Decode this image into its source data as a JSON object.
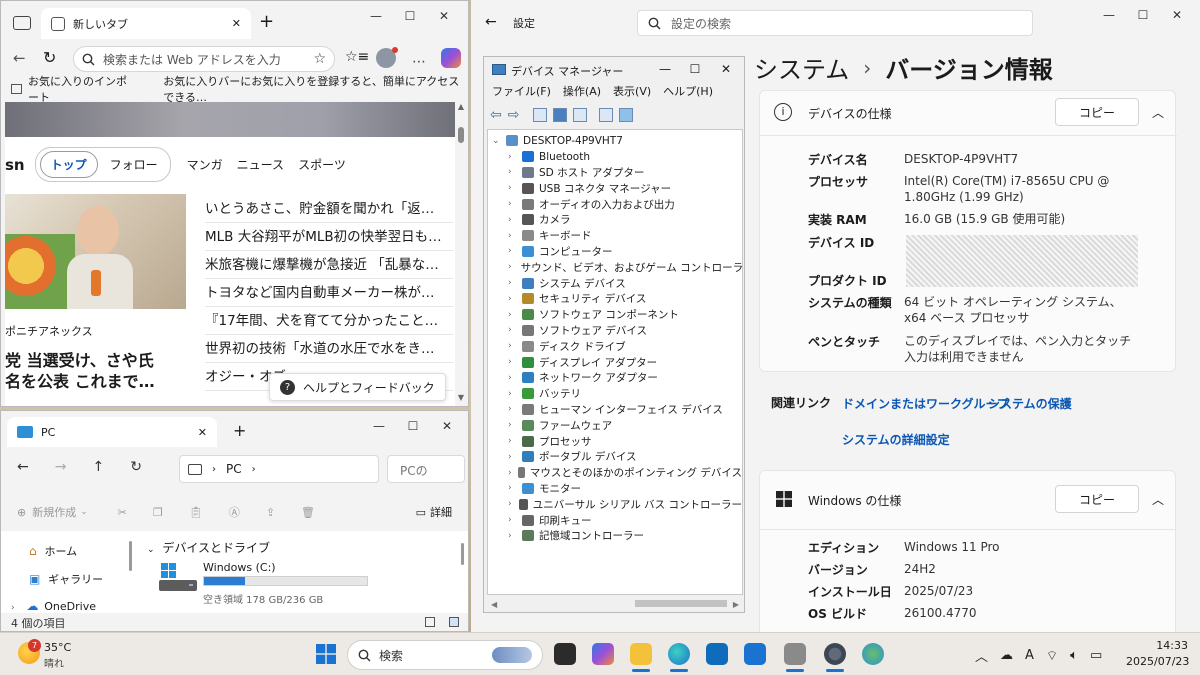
{
  "browser": {
    "tab_title": "新しいタブ",
    "address_placeholder": "検索または Web アドレスを入力",
    "favorites_import": "お気に入りのインポート",
    "favorites_hint": "お気に入りバーにお気に入りを登録すると、簡単にアクセスできる…",
    "logo_fragment": "sn",
    "tabs": [
      "トップ",
      "フォロー",
      "マンガ",
      "ニュース",
      "スポーツ"
    ],
    "news": [
      "いとうあさこ、貯金額を聞かれ「返…",
      "MLB 大谷翔平がMLB初の快挙翌日も…",
      "米旅客機に爆撃機が急接近 「乱暴な…",
      "トヨタなど国内自動車メーカー株が…",
      "『17年間、犬を育てて分かったこと…",
      "世界初の技術「水道の水圧で水をき…",
      "オジー・オズ…"
    ],
    "source": "ポニチアネックス",
    "headline_line1": "党 当選受け、さや氏",
    "headline_line2": "名を公表 これまで…",
    "help_button": "ヘルプとフィードバック"
  },
  "explorer": {
    "tab_title": "PC",
    "address_pc": "PC",
    "search_placeholder": "PCの",
    "new_label": "新規作成",
    "details_label": "詳細",
    "nav": [
      "ホーム",
      "ギャラリー",
      "OneDrive"
    ],
    "section": "デバイスとドライブ",
    "drive_name": "Windows (C:)",
    "drive_free": "空き領域 178 GB/236 GB",
    "drive_used_fraction": 0.25,
    "status": "4 個の項目"
  },
  "devmgr": {
    "title": "デバイス マネージャー",
    "menu": [
      "ファイル(F)",
      "操作(A)",
      "表示(V)",
      "ヘルプ(H)"
    ],
    "root": "DESKTOP-4P9VHT7",
    "items": [
      {
        "label": "Bluetooth",
        "color": "#1a6fd6"
      },
      {
        "label": "SD ホスト アダプター",
        "color": "#6b7b8c"
      },
      {
        "label": "USB コネクタ マネージャー",
        "color": "#555555"
      },
      {
        "label": "オーディオの入力および出力",
        "color": "#7a7a7a"
      },
      {
        "label": "カメラ",
        "color": "#555555"
      },
      {
        "label": "キーボード",
        "color": "#8a8a8a"
      },
      {
        "label": "コンピューター",
        "color": "#3b8fd4"
      },
      {
        "label": "サウンド、ビデオ、およびゲーム コントローラー",
        "color": "#6a6a6a"
      },
      {
        "label": "システム デバイス",
        "color": "#3f7fbf"
      },
      {
        "label": "セキュリティ デバイス",
        "color": "#b58b2a"
      },
      {
        "label": "ソフトウェア コンポーネント",
        "color": "#4a8a4a"
      },
      {
        "label": "ソフトウェア デバイス",
        "color": "#777777"
      },
      {
        "label": "ディスク ドライブ",
        "color": "#8a8a8a"
      },
      {
        "label": "ディスプレイ アダプター",
        "color": "#2f8f3f"
      },
      {
        "label": "ネットワーク アダプター",
        "color": "#2f7fbf"
      },
      {
        "label": "バッテリ",
        "color": "#3a9a3a"
      },
      {
        "label": "ヒューマン インターフェイス デバイス",
        "color": "#7a7a7a"
      },
      {
        "label": "ファームウェア",
        "color": "#5a8a5a"
      },
      {
        "label": "プロセッサ",
        "color": "#4a6a4a"
      },
      {
        "label": "ポータブル デバイス",
        "color": "#2f7fbf"
      },
      {
        "label": "マウスとそのほかのポインティング デバイス",
        "color": "#777777"
      },
      {
        "label": "モニター",
        "color": "#3b8fd4"
      },
      {
        "label": "ユニバーサル シリアル バス コントローラー",
        "color": "#555555"
      },
      {
        "label": "印刷キュー",
        "color": "#666666"
      },
      {
        "label": "記憶域コントローラー",
        "color": "#5a7a5a"
      }
    ]
  },
  "settings": {
    "app_title": "設定",
    "search_placeholder": "設定の検索",
    "breadcrumb_parent": "システム",
    "breadcrumb_sep": "›",
    "breadcrumb_current": "バージョン情報",
    "device_card_title": "デバイスの仕様",
    "copy_label": "コピー",
    "device_specs": [
      {
        "key": "デバイス名",
        "value": "DESKTOP-4P9VHT7"
      },
      {
        "key": "プロセッサ",
        "value": "Intel(R) Core(TM) i7-8565U CPU @ 1.80GHz (1.99 GHz)"
      },
      {
        "key": "実装 RAM",
        "value": "16.0 GB (15.9 GB 使用可能)"
      },
      {
        "key": "デバイス ID",
        "value": ""
      },
      {
        "key": "プロダクト ID",
        "value": ""
      },
      {
        "key": "システムの種類",
        "value": "64 ビット オペレーティング システム、x64 ベース プロセッサ"
      },
      {
        "key": "ペンとタッチ",
        "value": "このディスプレイでは、ペン入力とタッチ入力は利用できません"
      }
    ],
    "related_label": "関連リンク",
    "links": [
      "ドメインまたはワークグループ",
      "システムの保護",
      "システムの詳細設定"
    ],
    "windows_card_title": "Windows の仕様",
    "windows_specs": [
      {
        "key": "エディション",
        "value": "Windows 11 Pro"
      },
      {
        "key": "バージョン",
        "value": "24H2"
      },
      {
        "key": "インストール日",
        "value": "2025/07/23"
      },
      {
        "key": "OS ビルド",
        "value": "26100.4770"
      }
    ]
  },
  "taskbar": {
    "weather_temp": "35°C",
    "weather_desc": "晴れ",
    "weather_badge": "7",
    "search_label": "検索",
    "time": "14:33",
    "date": "2025/07/23",
    "ime": "A"
  }
}
